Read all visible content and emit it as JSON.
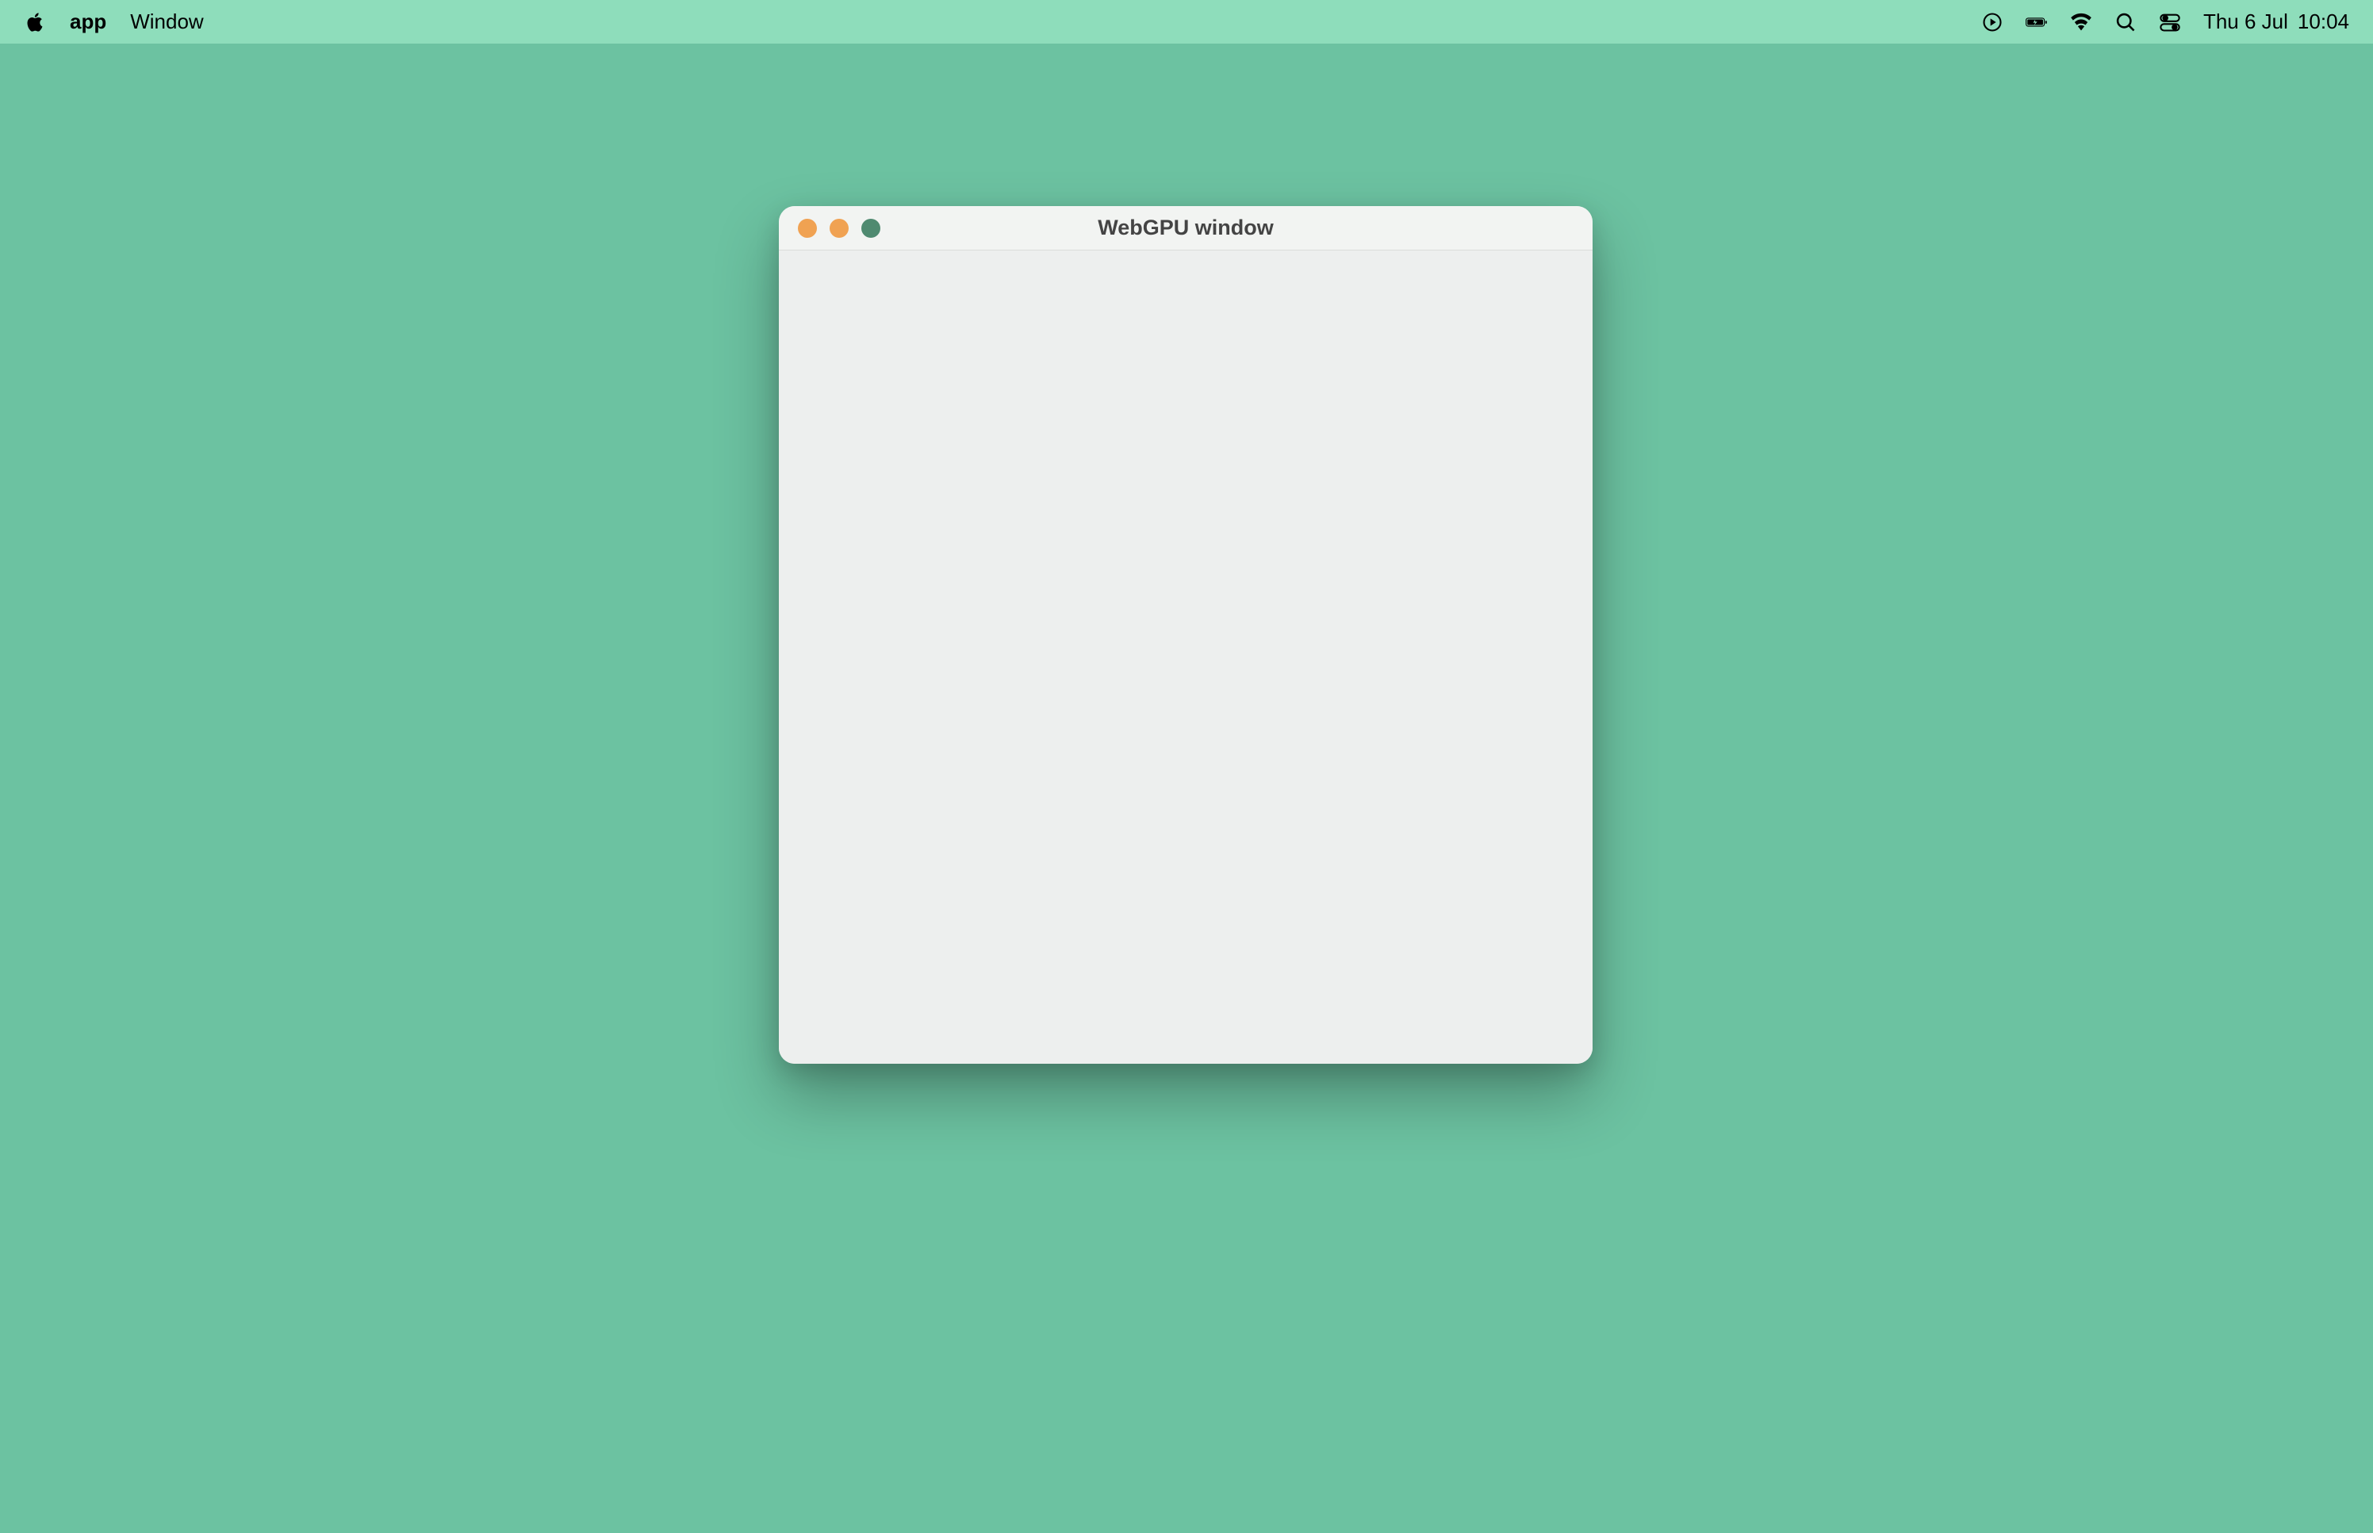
{
  "menubar": {
    "app_name": "app",
    "menu_items": [
      "Window"
    ],
    "date": "Thu 6 Jul",
    "time": "10:04"
  },
  "window": {
    "title": "WebGPU window"
  },
  "icons": {
    "apple": "apple-icon",
    "play": "play-icon",
    "battery": "battery-icon",
    "wifi": "wifi-icon",
    "search": "search-icon",
    "control_center": "control-center-icon"
  }
}
